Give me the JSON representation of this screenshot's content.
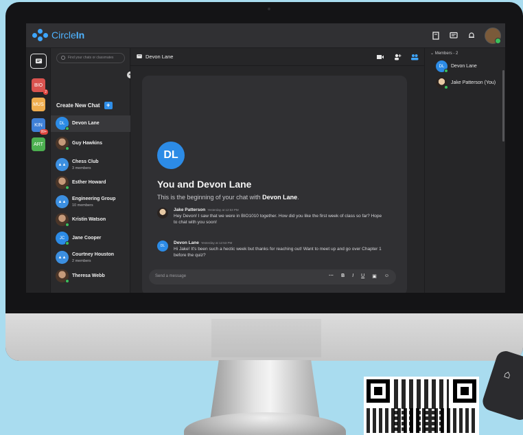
{
  "app": {
    "logo_part1": "Circle",
    "logo_part2": "In"
  },
  "rail": {
    "classes": [
      {
        "label": "BIO",
        "color": "#d9534f",
        "badge": "2"
      },
      {
        "label": "MUS",
        "color": "#f0ad4e",
        "badge": ""
      },
      {
        "label": "KIN",
        "color": "#3e7fd6",
        "badge": "99+"
      },
      {
        "label": "ART",
        "color": "#4caf50",
        "badge": ""
      }
    ]
  },
  "sidebar": {
    "search_placeholder": "Find your chats or classmates",
    "create_label": "Create New Chat",
    "chats": [
      {
        "name": "Devon Lane",
        "sub": "",
        "initials": "DL",
        "kind": "initials"
      },
      {
        "name": "Guy Hawkins",
        "sub": "",
        "initials": "",
        "kind": "photo"
      },
      {
        "name": "Chess Club",
        "sub": "3 members",
        "initials": "",
        "kind": "group"
      },
      {
        "name": "Esther Howard",
        "sub": "",
        "initials": "",
        "kind": "photo"
      },
      {
        "name": "Engineering Group",
        "sub": "10 members",
        "initials": "",
        "kind": "group"
      },
      {
        "name": "Kristin Watson",
        "sub": "",
        "initials": "",
        "kind": "photo"
      },
      {
        "name": "Jane Cooper",
        "sub": "",
        "initials": "JC",
        "kind": "initials"
      },
      {
        "name": "Courtney Houston",
        "sub": "2 members",
        "initials": "",
        "kind": "group"
      },
      {
        "name": "Theresa Webb",
        "sub": "",
        "initials": "",
        "kind": "photo"
      }
    ]
  },
  "main": {
    "title": "Devon Lane",
    "intro_initials": "DL",
    "intro_title": "You and Devon Lane",
    "intro_sub_prefix": "This is the beginning of your chat with ",
    "intro_sub_name": "Devon Lane",
    "intro_sub_suffix": ".",
    "messages": [
      {
        "name": "Jake Patterson",
        "time": "Yesterday at 12:53 PM",
        "text": "Hey Devon! I saw that we were in BIO1010 together. How did you like the first week of class so far? Hope to chat with you soon!"
      },
      {
        "name": "Devon Lane",
        "time": "Yesterday at 12:53 PM",
        "text": "Hi Jake! It's been such a hectic week but thanks for reaching out! Want to meet up and go over Chapter 1 before the quiz?"
      }
    ],
    "composer_placeholder": "Send a message",
    "tools": [
      "···",
      "B",
      "I",
      "U"
    ]
  },
  "members": {
    "title": "Members - 2",
    "list": [
      {
        "name": "Devon Lane",
        "initials": "DL"
      },
      {
        "name": "Jake Patterson (You)",
        "initials": ""
      }
    ]
  },
  "colors": {
    "accent": "#2c8be6",
    "online": "#3bbf5c"
  }
}
